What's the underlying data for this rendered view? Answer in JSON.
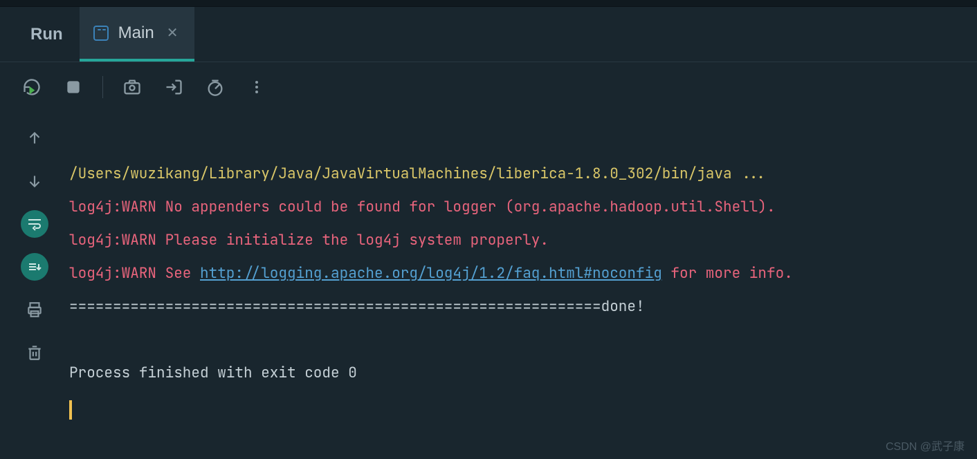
{
  "header": {
    "run_label": "Run",
    "tab_title": "Main"
  },
  "console": {
    "command": "/Users/wuzikang/Library/Java/JavaVirtualMachines/liberica-1.8.0_302/bin/java ...",
    "warn1": "log4j:WARN No appenders could be found for logger (org.apache.hadoop.util.Shell).",
    "warn2": "log4j:WARN Please initialize the log4j system properly.",
    "warn3_prefix": "log4j:WARN See ",
    "warn3_link": "http://logging.apache.org/log4j/1.2/faq.html#noconfig",
    "warn3_suffix": " for more info.",
    "separator": "=============================================================done!",
    "exit": "Process finished with exit code 0"
  },
  "watermark": "CSDN @武子康"
}
